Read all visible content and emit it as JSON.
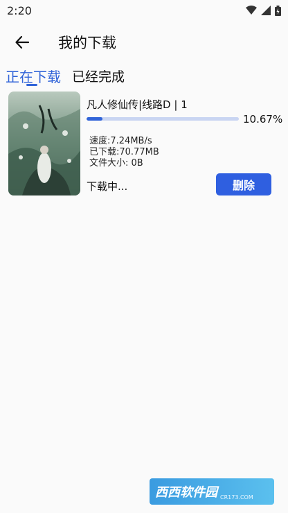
{
  "status_bar": {
    "time": "2:20"
  },
  "header": {
    "title": "我的下载"
  },
  "tabs": [
    {
      "label": "正在下载",
      "active": true
    },
    {
      "label": "已经完成",
      "active": false
    }
  ],
  "download": {
    "title": "凡人修仙传|线路D | 1",
    "progress_text": "10.67%",
    "progress_fraction": 0.1067,
    "speed": "速度:7.24MB/s",
    "downloaded": "已下载:70.77MB",
    "file_size": "文件大小:  0B",
    "status": "下载中...",
    "delete_label": "删除"
  },
  "watermark": {
    "main": "西西软件园",
    "sub": "CR173.COM"
  },
  "colors": {
    "accent": "#3164d8",
    "button": "#2f5fe0",
    "track": "#c9d5f2"
  }
}
